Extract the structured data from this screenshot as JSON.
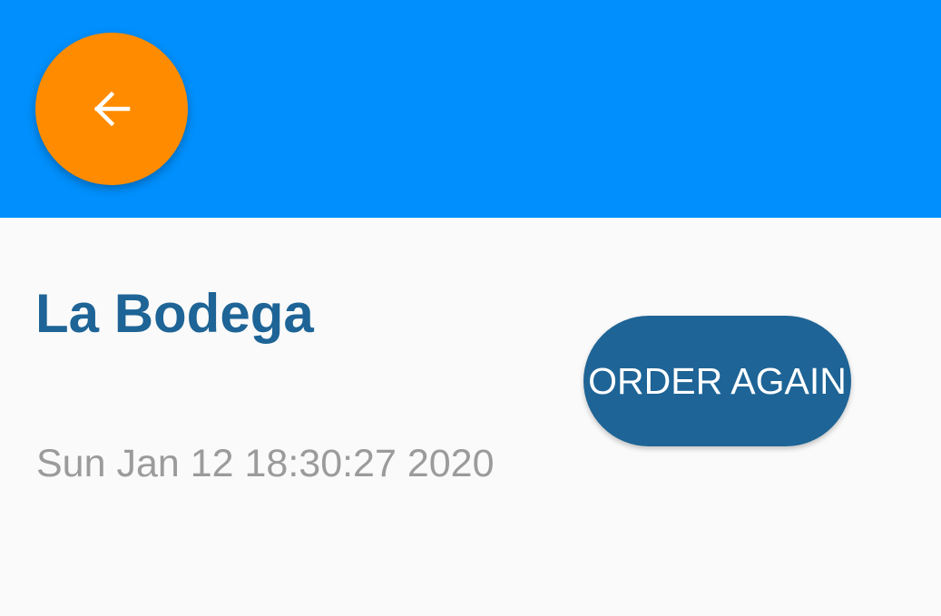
{
  "app_bar": {
    "back_icon": "arrow-left-icon",
    "colors": {
      "bar": "#008ffc",
      "back_button": "#ff8c00"
    }
  },
  "order": {
    "restaurant_name": "La Bodega",
    "date": "Sun Jan 12 18:30:27 2020",
    "order_again_label": "ORDER AGAIN",
    "colors": {
      "accent": "#1e6496",
      "date_text": "#9b9b9b"
    }
  }
}
